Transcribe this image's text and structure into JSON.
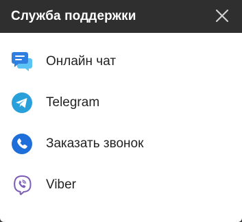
{
  "header": {
    "title": "Служба поддержки",
    "close_icon": "close-icon"
  },
  "items": [
    {
      "label": "Онлайн чат",
      "icon": "chat-icon",
      "color": "#2f9bee"
    },
    {
      "label": "Telegram",
      "icon": "telegram-icon",
      "color": "#2aa0da"
    },
    {
      "label": "Заказать звонок",
      "icon": "phone-icon",
      "color": "#1e6fd9"
    },
    {
      "label": "Viber",
      "icon": "viber-icon",
      "color": "#7c5cb8"
    }
  ]
}
